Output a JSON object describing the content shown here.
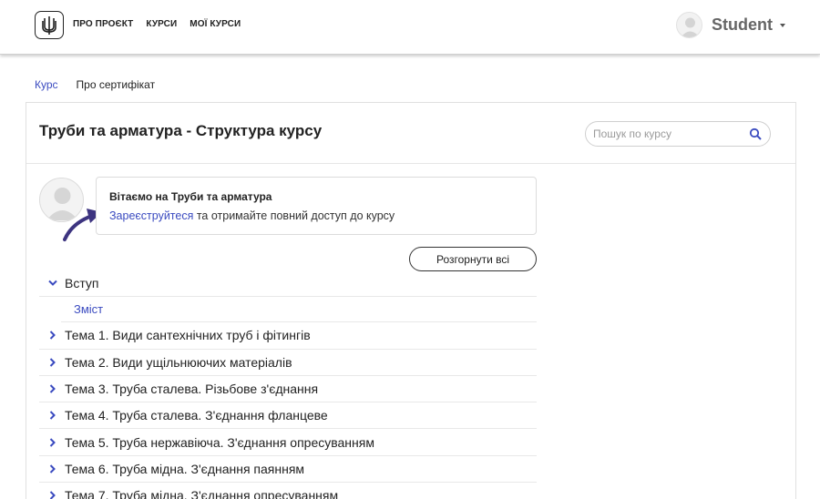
{
  "header": {
    "logo": "trident-logo-icon",
    "nav": [
      "ПРО ПРОЄКТ",
      "КУРСИ",
      "МОЇ КУРСИ"
    ],
    "user": {
      "name": "Student",
      "avatar": "user-avatar-icon",
      "menu_icon": "caret-down-icon"
    }
  },
  "tabs": [
    {
      "label": "Курс",
      "active": true
    },
    {
      "label": "Про сертифікат",
      "active": false
    }
  ],
  "course": {
    "title": "Труби та арматура - Структура курсу",
    "search": {
      "placeholder": "Пошук по курсу",
      "value": "",
      "icon": "search-icon"
    }
  },
  "welcome": {
    "title": "Вітаємо на Труби та арматура",
    "register_link": "Зареєструйтеся",
    "text_after_link": " та отримайте повний доступ до курсу"
  },
  "expand_all_label": "Розгорнути всі",
  "outline": {
    "intro": {
      "title": "Вступ",
      "expanded": true,
      "subsections": [
        "Зміст"
      ]
    },
    "sections": [
      "Тема 1. Види сантехнічних труб і фітингів",
      "Тема 2. Види ущільнюючих матеріалів",
      "Тема 3. Труба сталева. Різьбове з'єднання",
      "Тема 4. Труба сталева. З'єднання фланцеве",
      "Тема 5. Труба нержавіюча. З'єднання опресуванням",
      "Тема 6. Труба мідна. З'єднання паянням",
      "Тема 7. Труба мідна. З'єднання опресуванням"
    ]
  },
  "colors": {
    "accent": "#3b4bc0",
    "arrow": "#3d3480"
  }
}
